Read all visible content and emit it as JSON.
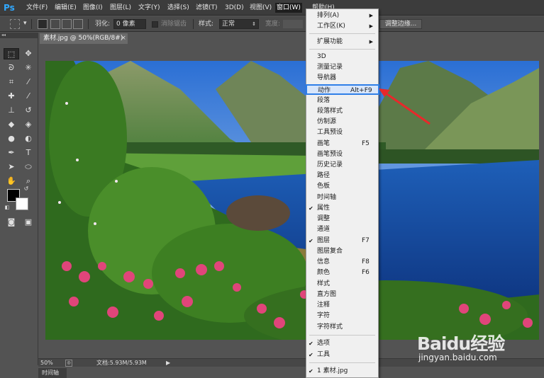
{
  "app": {
    "logo": "Ps"
  },
  "menubar": {
    "items": [
      "文件(F)",
      "编辑(E)",
      "图像(I)",
      "图层(L)",
      "文字(Y)",
      "选择(S)",
      "滤镜(T)",
      "3D(D)",
      "视图(V)",
      "窗口(W)",
      "帮助(H)"
    ]
  },
  "options": {
    "feather_label": "羽化:",
    "feather_value": "0 像素",
    "antialias_label": "消除锯齿",
    "style_label": "样式:",
    "style_value": "正常",
    "width_label": "宽度:",
    "refine_edge": "调整边缘..."
  },
  "document": {
    "tab_title": "素材.jpg @ 50%(RGB/8#)",
    "close": "×"
  },
  "status": {
    "zoom": "50%",
    "doc_size": "文档:5.93M/5.93M"
  },
  "timeline_tab": "时间轴",
  "window_menu": {
    "items": [
      {
        "label": "排列(A)",
        "submenu": true
      },
      {
        "label": "工作区(K)",
        "submenu": true
      },
      {
        "label": "扩展功能",
        "submenu": true
      },
      {
        "label": "3D"
      },
      {
        "label": "测量记录"
      },
      {
        "label": "导航器"
      },
      {
        "label": "动作",
        "shortcut": "Alt+F9",
        "highlighted": true
      },
      {
        "label": "段落"
      },
      {
        "label": "段落样式"
      },
      {
        "label": "仿制源"
      },
      {
        "label": "工具预设"
      },
      {
        "label": "画笔",
        "shortcut": "F5"
      },
      {
        "label": "画笔预设"
      },
      {
        "label": "历史记录"
      },
      {
        "label": "路径"
      },
      {
        "label": "色板"
      },
      {
        "label": "时间轴"
      },
      {
        "label": "属性",
        "checked": true
      },
      {
        "label": "调整"
      },
      {
        "label": "通道"
      },
      {
        "label": "图层",
        "shortcut": "F7",
        "checked": true
      },
      {
        "label": "图层复合"
      },
      {
        "label": "信息",
        "shortcut": "F8"
      },
      {
        "label": "颜色",
        "shortcut": "F6"
      },
      {
        "label": "样式"
      },
      {
        "label": "直方图"
      },
      {
        "label": "注释"
      },
      {
        "label": "字符"
      },
      {
        "label": "字符样式"
      },
      {
        "label": "选项",
        "checked": true
      },
      {
        "label": "工具",
        "checked": true
      },
      {
        "label": "1 素材.jpg",
        "checked": true
      }
    ]
  },
  "watermark": {
    "brand": "Baidu经验",
    "url": "jingyan.baidu.com"
  },
  "colors": {
    "highlight_border": "#2f7fe8",
    "arrow": "#e8282b",
    "foreground": "#000000",
    "background": "#ffffff"
  }
}
